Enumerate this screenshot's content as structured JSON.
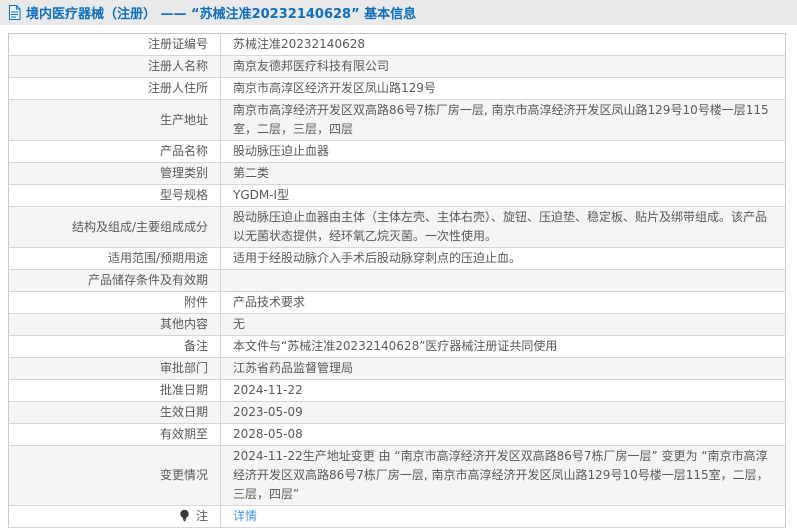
{
  "header": {
    "title": "境内医疗器械（注册） —— “苏械注准20232140628” 基本信息"
  },
  "table": {
    "rows": [
      {
        "label": "注册证编号",
        "value": "苏械注准20232140628"
      },
      {
        "label": "注册人名称",
        "value": "南京友德邦医疗科技有限公司"
      },
      {
        "label": "注册人住所",
        "value": "南京市高淳区经济开发区凤山路129号"
      },
      {
        "label": "生产地址",
        "value": "南京市高淳经济开发区双高路86号7栋厂房一层, 南京市高淳经济开发区凤山路129号10号楼一层115室，二层，三层，四层"
      },
      {
        "label": "产品名称",
        "value": "股动脉压迫止血器"
      },
      {
        "label": "管理类别",
        "value": "第二类"
      },
      {
        "label": "型号规格",
        "value": "YGDM-I型"
      },
      {
        "label": "结构及组成/主要组成成分",
        "value": "股动脉压迫止血器由主体（主体左壳、主体右壳）、旋钮、压迫垫、稳定板、贴片及绑带组成。该产品以无菌状态提供，经环氧乙烷灭菌。一次性使用。"
      },
      {
        "label": "适用范围/预期用途",
        "value": "适用于经股动脉介入手术后股动脉穿刺点的压迫止血。"
      },
      {
        "label": "产品储存条件及有效期",
        "value": ""
      },
      {
        "label": "附件",
        "value": "产品技术要求"
      },
      {
        "label": "其他内容",
        "value": "无"
      },
      {
        "label": "备注",
        "value": "本文件与“苏械注准20232140628”医疗器械注册证共同使用"
      },
      {
        "label": "审批部门",
        "value": "江苏省药品监督管理局"
      },
      {
        "label": "批准日期",
        "value": "2024-11-22"
      },
      {
        "label": "生效日期",
        "value": "2023-05-09"
      },
      {
        "label": "有效期至",
        "value": "2028-05-08"
      },
      {
        "label": "变更情况",
        "value": "2024-11-22生产地址变更 由 “南京市高淳经济开发区双高路86号7栋厂房一层” 变更为 “南京市高淳经济开发区双高路86号7栋厂房一层, 南京市高淳经济开发区凤山路129号10号楼一层115室，二层，三层，四层”"
      },
      {
        "label": "注",
        "icon": "lightbulb-icon",
        "link": "详情"
      }
    ]
  },
  "colors": {
    "title_blue": "#0d6fbe",
    "link_blue": "#4596e0",
    "titlebar_bg": "#e9e9e9",
    "stripe_bg": "#f5f5f5",
    "border": "#d6d6d6",
    "text": "#595959"
  }
}
